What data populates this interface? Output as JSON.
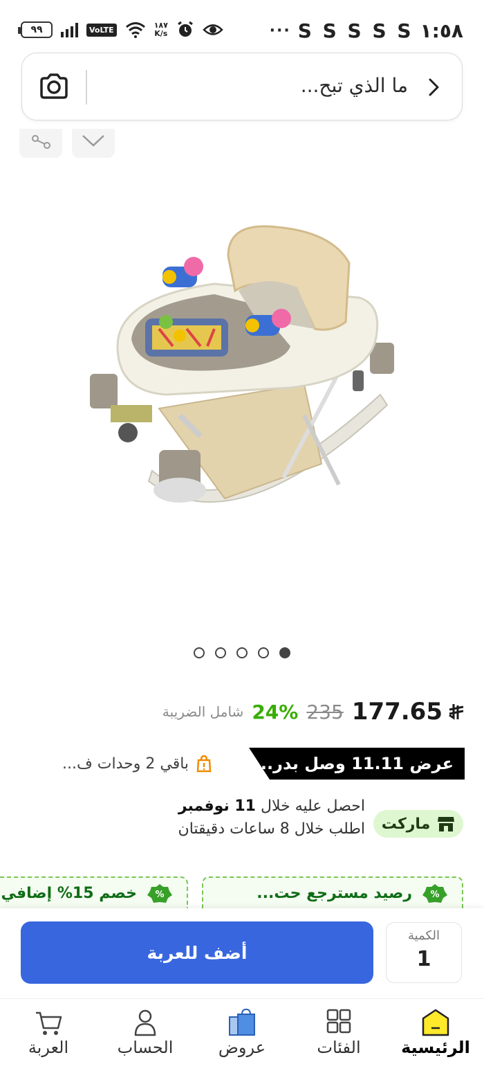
{
  "status_bar": {
    "time": "١:٥٨",
    "notification_icons": "S S S S S",
    "more": "···",
    "battery": "٩٩",
    "network_type": "VoLTE",
    "speed_value": "١٨٧",
    "speed_unit": "K/s"
  },
  "search": {
    "placeholder": "ما الذي تبح..."
  },
  "carousel": {
    "slide_count": 5,
    "active_slide": 5
  },
  "price": {
    "current": "177.65",
    "currency_symbol": "⃁",
    "old": "235",
    "discount": "24%",
    "tax_note": "شامل الضريبة"
  },
  "promo": {
    "banner": "عرض 11.11 وصل بدر...",
    "stock": "باقي 2 وحدات ف..."
  },
  "delivery": {
    "badge": "ماركت",
    "line1_prefix": "احصل عليه خلال",
    "line1_date": "11 نوفمبر",
    "line2": "اطلب خلال 8 ساعات دقيقتان"
  },
  "coupons": [
    {
      "text": "رصيد مسترجع حت..."
    },
    {
      "text": "خصم 15% إضافي"
    }
  ],
  "cart": {
    "add_button": "أضف للعربة",
    "quantity_label": "الكمية",
    "quantity_value": "1"
  },
  "nav": {
    "items": [
      {
        "label": "الرئيسية",
        "icon": "home-icon",
        "active": true
      },
      {
        "label": "الفئات",
        "icon": "categories-icon"
      },
      {
        "label": "عروض",
        "icon": "offers-icon"
      },
      {
        "label": "الحساب",
        "icon": "account-icon"
      },
      {
        "label": "العربة",
        "icon": "cart-icon"
      }
    ]
  },
  "colors": {
    "primary_button": "#3866df",
    "discount_green": "#38ae04",
    "promo_black": "#000000",
    "home_yellow": "#fee92b"
  }
}
